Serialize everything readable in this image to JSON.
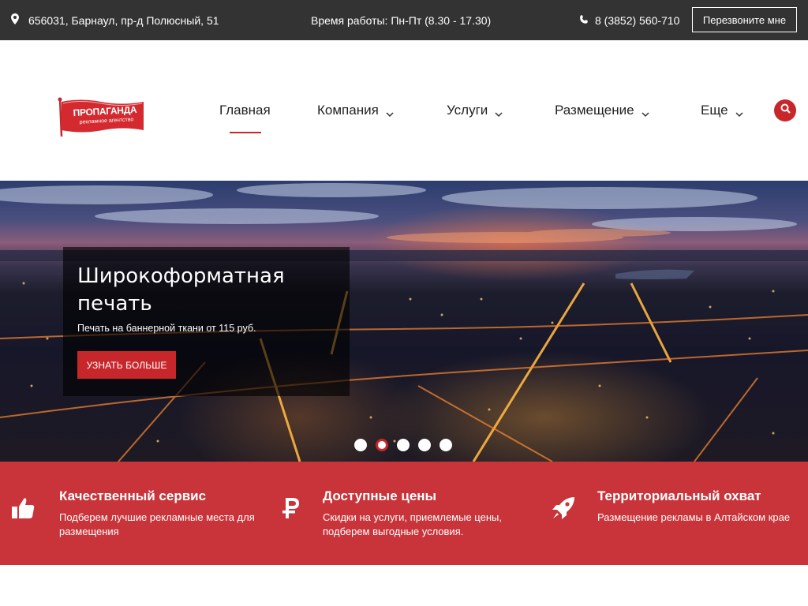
{
  "topbar": {
    "address": "656031, Барнаул, пр-д Полюсный, 51",
    "hours": "Время работы: Пн-Пт (8.30 - 17.30)",
    "phone": "8 (3852) 560-710",
    "callback_label": "Перезвоните мне",
    "icons": {
      "address": "map-pin-icon",
      "phone": "phone-icon"
    }
  },
  "logo": {
    "name": "ПРОПАГАНДА",
    "tagline": "рекламное агентство"
  },
  "nav": {
    "items": [
      {
        "label": "Главная",
        "dropdown": false,
        "active": true
      },
      {
        "label": "Компания",
        "dropdown": true,
        "active": false
      },
      {
        "label": "Услуги",
        "dropdown": true,
        "active": false
      },
      {
        "label": "Размещение",
        "dropdown": true,
        "active": false
      },
      {
        "label": "Еще",
        "dropdown": true,
        "active": false
      }
    ],
    "search_icon": "search-icon"
  },
  "hero": {
    "title": "Широкоформатная печать",
    "subtitle": "Печать на баннерной ткани от 115 руб.",
    "button_label": "УЗНАТЬ БОЛЬШЕ",
    "slides_total": 5,
    "active_slide": 2
  },
  "features": [
    {
      "icon": "thumbs-up-icon",
      "title": "Качественный сервис",
      "text": "Подберем лучшие рекламные места для размещения"
    },
    {
      "icon": "ruble-icon",
      "title": "Доступные цены",
      "text": "Скидки на услуги, приемлемые цены, подберем выгодные условия."
    },
    {
      "icon": "rocket-icon",
      "title": "Территориальный охват",
      "text": "Размещение рекламы в Алтайском крае"
    }
  ],
  "colors": {
    "accent": "#c7262b",
    "topbar_bg": "#333333",
    "features_bg": "#c8343a"
  }
}
